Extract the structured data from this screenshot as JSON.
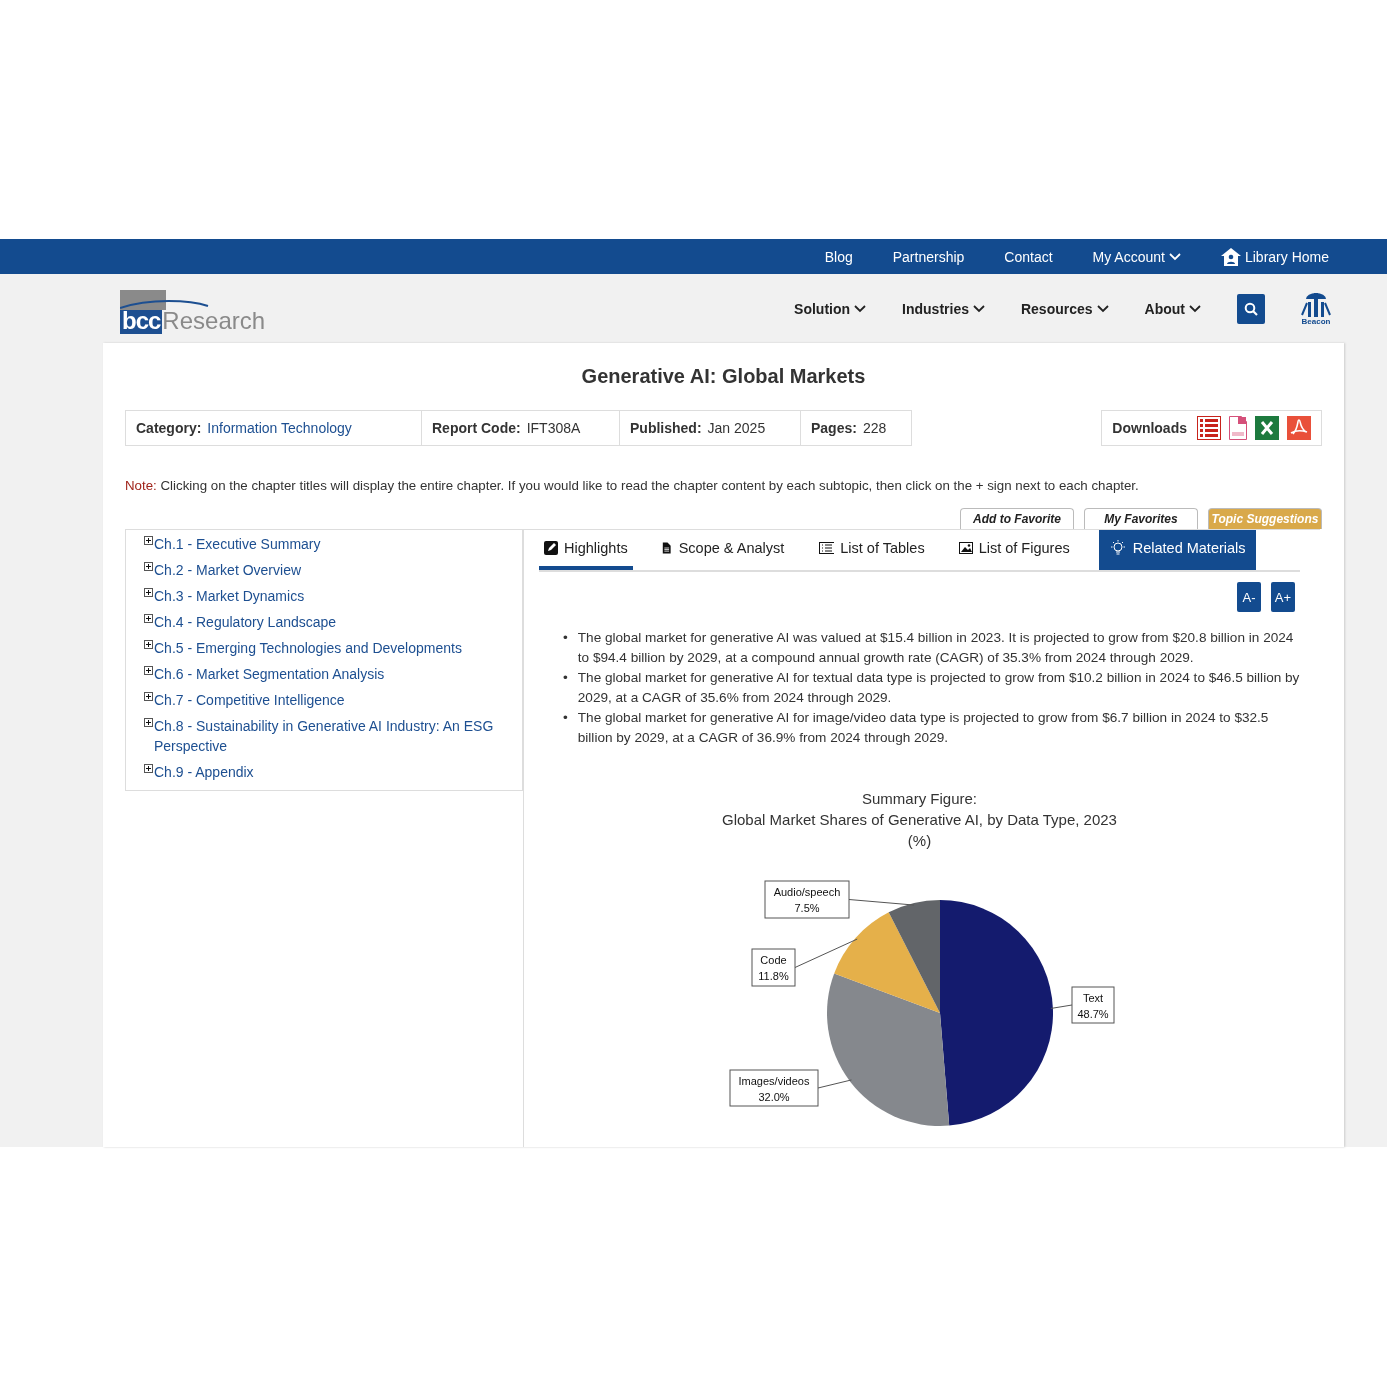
{
  "top_bar": {
    "links": [
      {
        "label": "Blog",
        "kind": "link"
      },
      {
        "label": "Partnership",
        "kind": "link"
      },
      {
        "label": "Contact",
        "kind": "link"
      },
      {
        "label": "My Account",
        "kind": "dropdown"
      },
      {
        "label": "Library Home",
        "kind": "home"
      }
    ]
  },
  "header": {
    "logo": {
      "mark": "bcc",
      "word": "Research"
    },
    "nav": [
      "Solution",
      "Industries",
      "Resources",
      "About"
    ],
    "beacon": "Beacon"
  },
  "report": {
    "title": "Generative AI: Global Markets",
    "meta": [
      {
        "label": "Category:",
        "value": "Information Technology",
        "kind": "link"
      },
      {
        "label": "Report Code:",
        "value": "IFT308A",
        "kind": "plain"
      },
      {
        "label": "Published:",
        "value": "Jan 2025",
        "kind": "plain"
      },
      {
        "label": "Pages:",
        "value": "228",
        "kind": "plain"
      }
    ],
    "downloads": {
      "label": "Downloads"
    },
    "note": {
      "label": "Note:",
      "text": "Clicking on the chapter titles will display the entire chapter. If you would like to read the chapter content by each subtopic, then click on the + sign next to each chapter."
    },
    "actions": [
      {
        "label": "Add to Favorite",
        "kind": "plain"
      },
      {
        "label": "My Favorites",
        "kind": "plain"
      },
      {
        "label": "Topic Suggestions",
        "kind": "accent"
      }
    ],
    "chapters": [
      "Ch.1 - Executive Summary",
      "Ch.2 - Market Overview",
      "Ch.3 - Market Dynamics",
      "Ch.4 - Regulatory Landscape",
      "Ch.5 - Emerging Technologies and Developments",
      "Ch.6 - Market Segmentation Analysis",
      "Ch.7 - Competitive Intelligence",
      "Ch.8 - Sustainability in Generative AI Industry: An ESG Perspective",
      "Ch.9 - Appendix"
    ],
    "tabs": [
      {
        "label": "Highlights",
        "selected": true,
        "kind": "tab"
      },
      {
        "label": "Scope & Analyst",
        "selected": false,
        "kind": "tab"
      },
      {
        "label": "List of Tables",
        "selected": false,
        "kind": "tab"
      },
      {
        "label": "List of Figures",
        "selected": false,
        "kind": "tab"
      },
      {
        "label": "Related Materials",
        "selected": false,
        "kind": "feature"
      }
    ],
    "font_buttons": [
      "A-",
      "A+"
    ],
    "highlights": [
      {
        "marker": "•",
        "text": "The global market for generative AI was valued at $15.4 billion in 2023. It is projected to grow from $20.8 billion in 2024 to $94.4 billion by 2029, at a compound annual growth rate (CAGR) of 35.3% from 2024 through 2029."
      },
      {
        "marker": "•",
        "text": "The global market for generative AI for textual data type is projected to grow from $10.2 billion in 2024 to $46.5 billion by 2029, at a CAGR of 35.6% from 2024 through 2029."
      },
      {
        "marker": "•",
        "text": "The global market for generative AI for image/video data type is projected to grow from $6.7 billion in 2024 to $32.5 billion by 2029, at a CAGR of 36.9% from 2024 through 2029."
      }
    ],
    "figure": {
      "title_lines": [
        "Summary Figure:",
        "Global Market Shares of Generative AI, by Data Type, 2023",
        "(%)"
      ],
      "chart_data": {
        "type": "pie",
        "categories": [
          "Text",
          "Images/videos",
          "Code",
          "Audio/speech"
        ],
        "values": [
          48.7,
          32.0,
          11.8,
          7.5
        ],
        "colors": [
          "#141b6e",
          "#85888d",
          "#e5b04a",
          "#626569"
        ],
        "value_labels": [
          "48.7%",
          "32.0%",
          "11.8%",
          "7.5%"
        ]
      }
    }
  }
}
